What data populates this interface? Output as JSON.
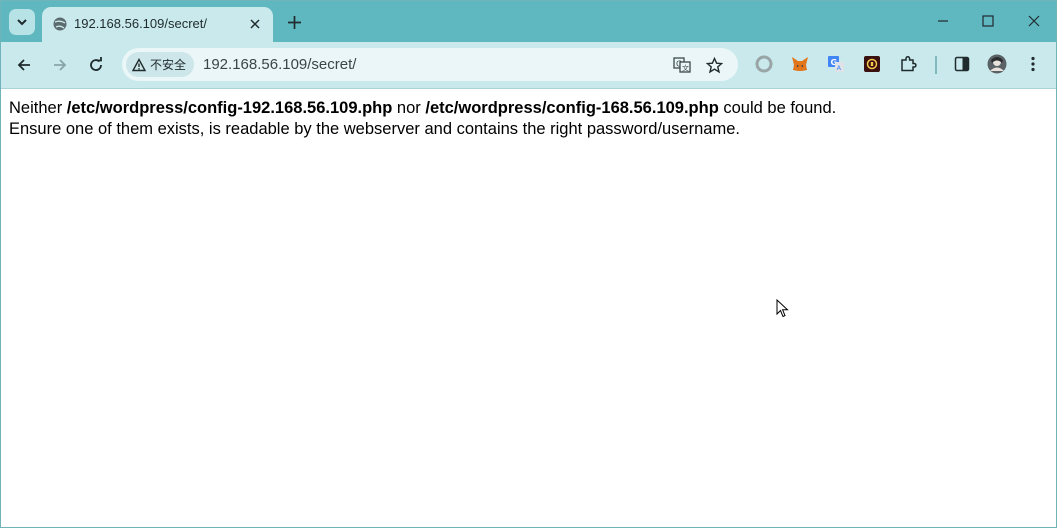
{
  "tab": {
    "title": "192.168.56.109/secret/"
  },
  "omnibox": {
    "security_label": "不安全",
    "url": "192.168.56.109/secret/"
  },
  "page": {
    "line1_prefix": "Neither ",
    "path1": "/etc/wordpress/config-192.168.56.109.php",
    "line1_mid": " nor ",
    "path2": "/etc/wordpress/config-168.56.109.php",
    "line1_suffix": " could be found.",
    "line2": "Ensure one of them exists, is readable by the webserver and contains the right password/username."
  },
  "icons": {
    "tab_search": "chevron-down-icon",
    "favicon": "globe-icon",
    "tab_close": "close-icon",
    "new_tab": "plus-icon",
    "minimize": "minimize-icon",
    "maximize": "maximize-icon",
    "close_window": "close-icon",
    "back": "arrow-left-icon",
    "forward": "arrow-right-icon",
    "reload": "reload-icon",
    "warning": "warning-icon",
    "translate": "translate-icon",
    "bookmark": "star-icon",
    "extensions": [
      "circle-extension-icon",
      "metamask-fox-icon",
      "google-translate-icon",
      "dark-extension-icon",
      "puzzle-icon"
    ],
    "side_panel": "side-panel-icon",
    "profile": "avatar-icon",
    "menu": "kebab-menu-icon"
  },
  "colors": {
    "tab_strip": "#5fb7bf",
    "toolbar": "#c9e9ec",
    "omnibox": "#eaf6f7"
  }
}
